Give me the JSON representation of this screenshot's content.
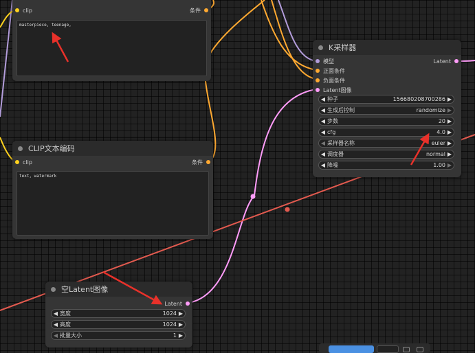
{
  "nodes": {
    "clip_top": {
      "input_label": "clip",
      "output_label": "条件",
      "text": "masterpiece, teenage,"
    },
    "clip_text_encode": {
      "title": "CLIP文本编码",
      "input_label": "clip",
      "output_label": "条件",
      "text": "text, watermark"
    },
    "ksampler": {
      "title": "K采样器",
      "inputs": [
        "模型",
        "正面条件",
        "负面条件",
        "Latent图像"
      ],
      "output_label": "Latent",
      "widgets": [
        {
          "label": "种子",
          "value": "156680208700286"
        },
        {
          "label": "生成后控制",
          "value": "randomize"
        },
        {
          "label": "步数",
          "value": "20"
        },
        {
          "label": "cfg",
          "value": "4.0"
        },
        {
          "label": "采样器名称",
          "value": "euler"
        },
        {
          "label": "调度器",
          "value": "normal"
        },
        {
          "label": "降噪",
          "value": "1.00"
        }
      ]
    },
    "empty_latent": {
      "title": "空Latent图像",
      "output_label": "Latent",
      "widgets": [
        {
          "label": "宽度",
          "value": "1024"
        },
        {
          "label": "高度",
          "value": "1024"
        },
        {
          "label": "批量大小",
          "value": "1"
        }
      ]
    }
  },
  "colors": {
    "clip_wire": "#b39ddb",
    "conditioning_wire": "#ffa931",
    "latent_wire": "#ff9cf9",
    "red_wire": "#e35a4f",
    "annotation_arrow": "#e8312a",
    "toolbar_blue": "#4a90e2"
  }
}
